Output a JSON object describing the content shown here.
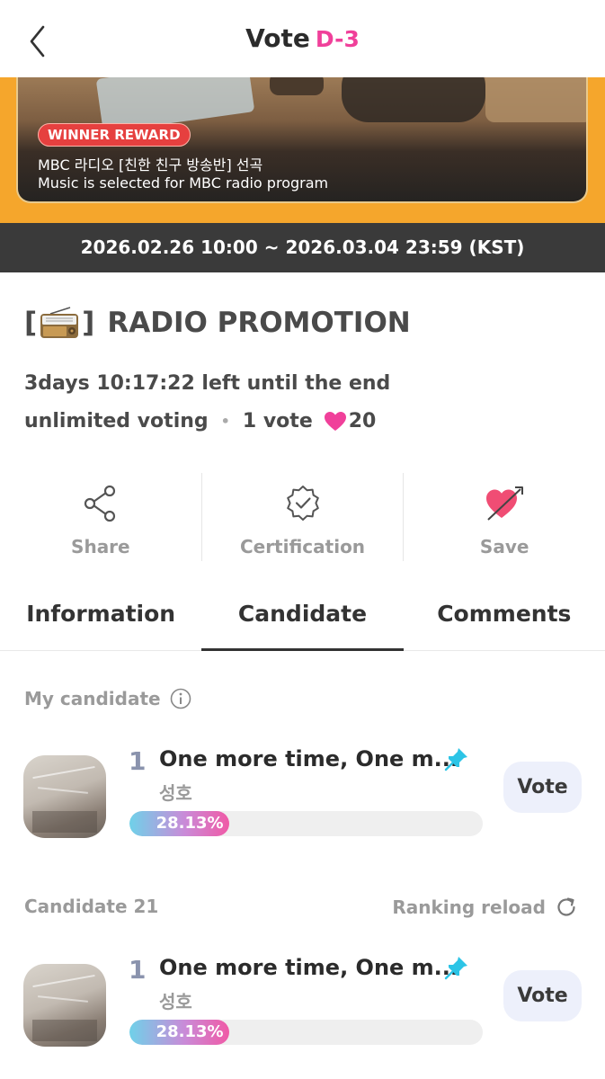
{
  "header": {
    "title": "Vote",
    "dday": "D-3"
  },
  "banner": {
    "badge": "WINNER REWARD",
    "line1": "MBC 라디오 [친한 친구 방송반] 선곡",
    "line2": "Music is selected for MBC radio program"
  },
  "period": "2026.02.26 10:00 ~ 2026.03.04 23:59 (KST)",
  "vote": {
    "title_open": "[",
    "title_close": "]",
    "title_text": "RADIO PROMOTION",
    "time_left": "3days 10:17:22 left until the end",
    "voting_mode": "unlimited voting",
    "dot": "•",
    "per_vote": "1 vote",
    "heart_cost": "20"
  },
  "actions": [
    {
      "label": "Share",
      "icon": "share-icon"
    },
    {
      "label": "Certification",
      "icon": "certification-badge-icon"
    },
    {
      "label": "Save",
      "icon": "heart-arrow-icon"
    }
  ],
  "tabs": [
    {
      "label": "Information",
      "active": false
    },
    {
      "label": "Candidate",
      "active": true
    },
    {
      "label": "Comments",
      "active": false
    }
  ],
  "my_candidate": {
    "label": "My candidate",
    "item": {
      "rank": "1",
      "title": "One more time, One m...",
      "artist": "성호",
      "percent": 28.13,
      "percent_label": "28.13%",
      "vote_label": "Vote"
    }
  },
  "candidates": {
    "label": "Candidate 21",
    "reload_label": "Ranking reload",
    "items": [
      {
        "rank": "1",
        "title": "One more time, One m...",
        "artist": "성호",
        "percent": 28.13,
        "percent_label": "28.13%",
        "vote_label": "Vote"
      }
    ]
  },
  "colors": {
    "accent_pink": "#f0409a",
    "banner_orange": "#f5a62c",
    "date_bar": "#3a3a3a",
    "vote_button_bg": "#edf0fb",
    "pin": "#2cc4e6"
  }
}
